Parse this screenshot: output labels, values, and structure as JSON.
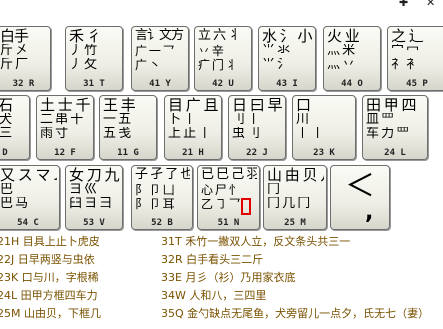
{
  "window": {
    "pin_icon": "pin-icon",
    "close_icon": "close-icon"
  },
  "keys": {
    "k32R": {
      "r1": "白手",
      "r2": "斤 㐅",
      "r3": "斤 厂",
      "code": "32 R"
    },
    "k31T": {
      "r1": "禾 彳",
      "r2": "丿 竹",
      "r3": "丿 攵",
      "code": "31 T"
    },
    "k41Y": {
      "r1": "言讠文方",
      "r2": "广 一 乛",
      "r3": "广 丶",
      "code": "41 Y"
    },
    "k42U": {
      "r1": "立 六 丬",
      "r2": "丷 辛",
      "r3": "疒 门 丬",
      "code": "42 U"
    },
    "k43I": {
      "r1": "水 氵 小",
      "r2": "⺌ 氺",
      "r3": "⺌ 氵",
      "code": "43 I"
    },
    "k44O": {
      "r1": "火 业",
      "r2": "灬 米",
      "r3": "灬 丷",
      "code": "44 O"
    },
    "k45P": {
      "r1": "之 辶",
      "r2": "宀 冖",
      "r3": "礻 衤",
      "code": "45 P"
    },
    "k15D": {
      "r1": "古石",
      "r2": "厂 犬",
      "r3": "ナ 三",
      "code": "D"
    },
    "k12F": {
      "r1": "土 士 千",
      "r2": "二 串 十",
      "r3": "雨 寸",
      "code": "12 F"
    },
    "k11G": {
      "r1": "王 丰",
      "r2": "一 五",
      "r3": "五 戋",
      "code": "11 G"
    },
    "k21H": {
      "r1": "目 广 且",
      "r2": "卜 丨",
      "r3": "上 止 丨",
      "code": "21 H"
    },
    "k22J": {
      "r1": "日 曰 早",
      "r2": "刂 丨",
      "r3": "虫 刂",
      "code": "22 J"
    },
    "k23K": {
      "r1": "口",
      "r2": "川",
      "r3": "丨 丨",
      "code": "23 K"
    },
    "k24L": {
      "r1": "田 甲 四",
      "r2": "皿 罒",
      "r3": "车 力 罒",
      "code": "24 L"
    },
    "k55C": {
      "r1": "又 ス マ ム",
      "r2": "巴",
      "r3": "巴 马",
      "code": "54 C"
    },
    "k53V": {
      "r1": "女 刀 九",
      "r2": "ヨ 巛",
      "r3": "臼 ヨ 彐",
      "code": "53 V"
    },
    "k52B": {
      "r1": "子 孑 了 也",
      "r2": "阝 卩 凵",
      "r3": "阝 卩 耳",
      "code": "52 B"
    },
    "k51N": {
      "r1": "已 巳 己 羽",
      "r2": "心 尸 忄",
      "r3": "乙 ㇆ 乛",
      "code": "51 N"
    },
    "k25M": {
      "r1": "山 由 贝 几",
      "r2": "冂",
      "r3": "冂 几 冂",
      "code": "25 M"
    },
    "kpunct": {
      "symbol": "＜",
      "comma": ","
    }
  },
  "lines": {
    "l21": "21H 目具上止卜虎皮",
    "l22": "22J 日早两竖与虫依",
    "l23": "23K 口与川，字根稀",
    "l24": "24L 田甲方框四车力",
    "l25": "25M 山由贝，下框几",
    "l31": "31T 禾竹一撇双人立，反文条头共三一",
    "l32": "32R 白手看头三二斤",
    "l33": "33E 月彡（衫）乃用家衣底",
    "l34": "34W 人和八，三四里",
    "l35": "35Q 金勺缺点无尾鱼，犬旁留儿一点夕，氏无七（妻）"
  }
}
